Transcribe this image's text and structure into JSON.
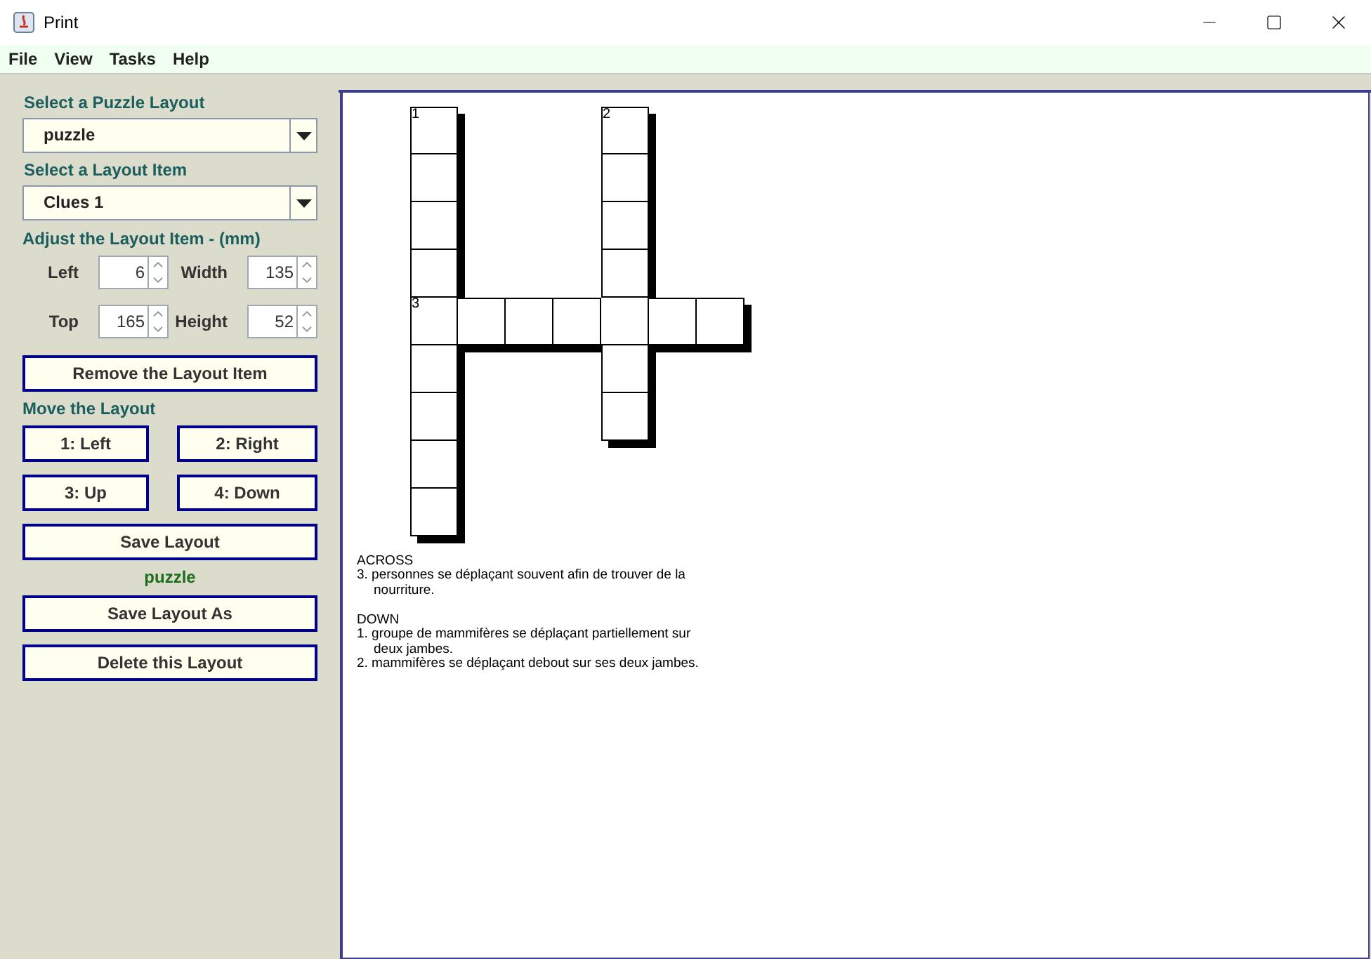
{
  "window": {
    "title": "Print"
  },
  "menu": [
    "File",
    "View",
    "Tasks",
    "Help"
  ],
  "sidebar": {
    "layout_label": "Select a Puzzle Layout",
    "layout_value": "puzzle",
    "item_label": "Select a Layout Item",
    "item_value": "Clues 1",
    "adjust_label": "Adjust the Layout Item - (mm)",
    "fields": [
      {
        "label": "Left",
        "value": "6"
      },
      {
        "label": "Width",
        "value": "135"
      },
      {
        "label": "Top",
        "value": "165"
      },
      {
        "label": "Height",
        "value": "52"
      }
    ],
    "remove_button": "Remove the Layout Item",
    "move_label": "Move the Layout",
    "move_buttons": [
      "1: Left",
      "2: Right",
      "3: Up",
      "4: Down"
    ],
    "save_button": "Save Layout",
    "current_layout": "puzzle",
    "save_as_button": "Save Layout As",
    "delete_button": "Delete this Layout"
  },
  "crossword": {
    "rows": [
      [
        {
          "kind": "box",
          "number": "1"
        },
        {
          "kind": "blank"
        },
        {
          "kind": "blank"
        },
        {
          "kind": "blank"
        },
        {
          "kind": "box",
          "number": "2"
        },
        {
          "kind": "blank"
        },
        {
          "kind": "blank"
        }
      ],
      [
        {
          "kind": "box"
        },
        {
          "kind": "blank"
        },
        {
          "kind": "blank"
        },
        {
          "kind": "blank"
        },
        {
          "kind": "box"
        },
        {
          "kind": "blank"
        },
        {
          "kind": "blank"
        }
      ],
      [
        {
          "kind": "box"
        },
        {
          "kind": "blank"
        },
        {
          "kind": "blank"
        },
        {
          "kind": "blank"
        },
        {
          "kind": "box"
        },
        {
          "kind": "blank"
        },
        {
          "kind": "blank"
        }
      ],
      [
        {
          "kind": "box"
        },
        {
          "kind": "blank"
        },
        {
          "kind": "blank"
        },
        {
          "kind": "blank"
        },
        {
          "kind": "box"
        },
        {
          "kind": "blank"
        },
        {
          "kind": "blank"
        }
      ],
      [
        {
          "kind": "box",
          "number": "3"
        },
        {
          "kind": "box"
        },
        {
          "kind": "box"
        },
        {
          "kind": "box"
        },
        {
          "kind": "box"
        },
        {
          "kind": "box"
        },
        {
          "kind": "box"
        }
      ],
      [
        {
          "kind": "box"
        },
        {
          "kind": "blank"
        },
        {
          "kind": "blank"
        },
        {
          "kind": "blank"
        },
        {
          "kind": "box"
        },
        {
          "kind": "blank"
        },
        {
          "kind": "blank"
        }
      ],
      [
        {
          "kind": "box"
        },
        {
          "kind": "blank"
        },
        {
          "kind": "blank"
        },
        {
          "kind": "blank"
        },
        {
          "kind": "box"
        },
        {
          "kind": "blank"
        },
        {
          "kind": "blank"
        }
      ],
      [
        {
          "kind": "box"
        },
        {
          "kind": "blank"
        },
        {
          "kind": "blank"
        },
        {
          "kind": "blank"
        },
        {
          "kind": "blank"
        },
        {
          "kind": "blank"
        },
        {
          "kind": "blank"
        }
      ],
      [
        {
          "kind": "box"
        },
        {
          "kind": "blank"
        },
        {
          "kind": "blank"
        },
        {
          "kind": "blank"
        },
        {
          "kind": "blank"
        },
        {
          "kind": "blank"
        },
        {
          "kind": "blank"
        }
      ]
    ]
  },
  "clues": [
    {
      "heading": "ACROSS",
      "items": [
        "3. personnes se déplaçant souvent afin de trouver de la nourriture."
      ]
    },
    {
      "heading": "DOWN",
      "items": [
        "1. groupe de mammifères se déplaçant partiellement sur deux jambes.",
        "2. mammifères se déplaçant debout sur ses deux jambes."
      ]
    }
  ]
}
